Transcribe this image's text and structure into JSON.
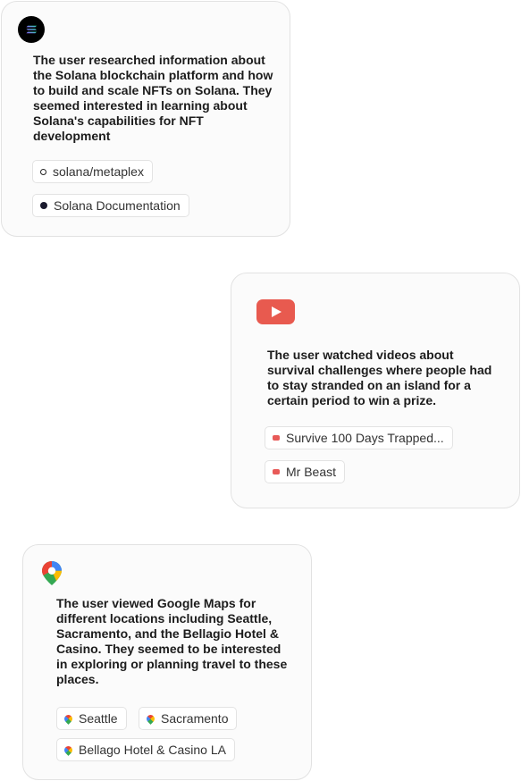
{
  "cards": [
    {
      "app": "solana",
      "icon": "solana-logo-icon",
      "summary": "The user researched information about the Solana blockchain platform and how to build and scale NFTs on Solana. They seemed interested in learning about Solana's capabilities for NFT development",
      "chips": [
        {
          "label": "solana/metaplex",
          "icon": "github-icon"
        },
        {
          "label": "Solana Documentation",
          "icon": "solana-icon"
        }
      ]
    },
    {
      "app": "youtube",
      "icon": "youtube-logo-icon",
      "accent": "#e85a4f",
      "summary": "The user watched videos about survival challenges where people had to stay stranded on an island for a certain period to win a prize.",
      "chips": [
        {
          "label": "Survive 100 Days Trapped...",
          "icon": "youtube-icon"
        },
        {
          "label": "Mr Beast",
          "icon": "youtube-icon"
        }
      ]
    },
    {
      "app": "google-maps",
      "icon": "google-maps-logo-icon",
      "summary": "The user viewed Google Maps for different locations including Seattle, Sacramento, and the Bellagio Hotel & Casino. They seemed to be interested in exploring or planning travel to these places.",
      "chips": [
        {
          "label": "Seattle",
          "icon": "google-maps-icon"
        },
        {
          "label": "Sacramento",
          "icon": "google-maps-icon"
        },
        {
          "label": "Bellago Hotel & Casino LA",
          "icon": "google-maps-icon"
        }
      ]
    }
  ]
}
